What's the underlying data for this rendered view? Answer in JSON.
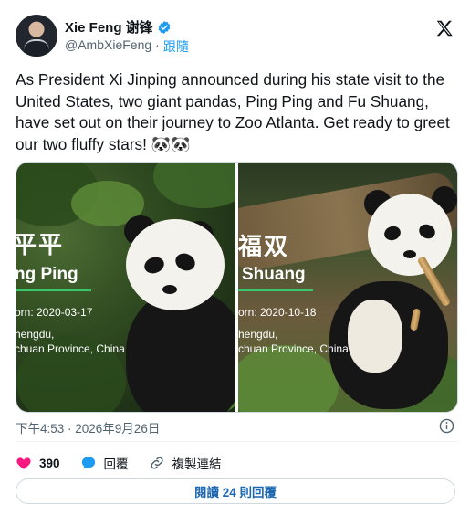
{
  "author": {
    "display_name": "Xie Feng 谢锋",
    "handle": "@AmbXieFeng",
    "separator": "·",
    "follow_label": "跟隨"
  },
  "tweet": {
    "text": "As President Xi Jinping announced during his state visit to the United States, two giant pandas, Ping Ping and Fu Shuang, have set out on their journey to Zoo Atlanta. Get ready to greet our two fluffy stars! 🐼🐼",
    "timestamp": "下午4:53 · 2026年9月26日"
  },
  "media": {
    "left": {
      "cn_name": "平平",
      "en_name": "ng Ping",
      "born": "orn: 2020-03-17",
      "place_line1": "hengdu,",
      "place_line2": "chuan Province, China"
    },
    "right": {
      "cn_name": "福双",
      "en_name": "Shuang",
      "born": "orn: 2020-10-18",
      "place_line1": "hengdu,",
      "place_line2": "chuan Province, China"
    }
  },
  "actions": {
    "likes": "390",
    "reply_label": "回覆",
    "copy_link_label": "複製連結"
  },
  "read_replies_label": "閱讀 24 則回覆",
  "colors": {
    "accent": "#1d9bf0",
    "like": "#f91880",
    "text": "#0f1419",
    "muted": "#536471"
  },
  "icons": [
    "verified-badge-icon",
    "x-logo-icon",
    "info-icon",
    "heart-icon",
    "reply-bubble-icon",
    "link-icon"
  ]
}
